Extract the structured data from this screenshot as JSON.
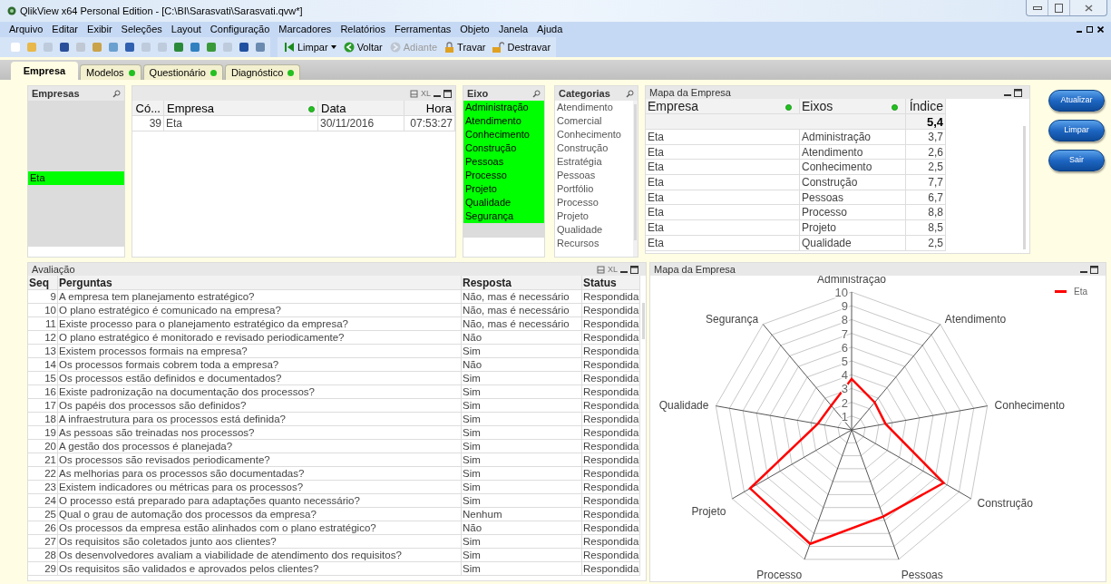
{
  "window": {
    "title": "QlikView x64 Personal Edition - [C:\\BI\\Sarasvati\\Sarasvati.qvw*]"
  },
  "menu": [
    "Arquivo",
    "Editar",
    "Exibir",
    "Seleções",
    "Layout",
    "Configuração",
    "Marcadores",
    "Relatórios",
    "Ferramentas",
    "Objeto",
    "Janela",
    "Ajuda"
  ],
  "toolbar": [
    {
      "kind": "clear",
      "label": "Limpar",
      "disabled": false
    },
    {
      "kind": "back",
      "label": "Voltar",
      "disabled": false
    },
    {
      "kind": "forward",
      "label": "Adiante",
      "disabled": true
    },
    {
      "kind": "lock",
      "label": "Travar",
      "disabled": false
    },
    {
      "kind": "unlock",
      "label": "Destravar",
      "disabled": false
    }
  ],
  "tabs": [
    {
      "label": "Empresa",
      "selected": true,
      "dot": false
    },
    {
      "label": "Modelos",
      "selected": false,
      "dot": true
    },
    {
      "label": "Questionário",
      "selected": false,
      "dot": true
    },
    {
      "label": "Diagnóstico",
      "selected": false,
      "dot": true
    }
  ],
  "empresas_list": {
    "title": "Empresas",
    "items": [
      {
        "label": "Eta",
        "selected": true
      }
    ]
  },
  "registro_table": {
    "export_label": "XL",
    "columns": [
      {
        "label": "Có...",
        "filtered": false
      },
      {
        "label": "Empresa",
        "filtered": true
      },
      {
        "label": "Data",
        "filtered": false
      },
      {
        "label": "Hora",
        "filtered": false
      }
    ],
    "rows": [
      [
        "39",
        "Eta",
        "30/11/2016",
        "07:53:27"
      ]
    ]
  },
  "eixo_list": {
    "title": "Eixo",
    "items": [
      {
        "label": "Administração",
        "selected": true
      },
      {
        "label": "Atendimento",
        "selected": true
      },
      {
        "label": "Conhecimento",
        "selected": true
      },
      {
        "label": "Construção",
        "selected": true
      },
      {
        "label": "Pessoas",
        "selected": true
      },
      {
        "label": "Processo",
        "selected": true
      },
      {
        "label": "Projeto",
        "selected": true
      },
      {
        "label": "Qualidade",
        "selected": true
      },
      {
        "label": "Segurança",
        "selected": true
      }
    ]
  },
  "categorias_list": {
    "title": "Categorias",
    "items": [
      {
        "label": "Atendimento",
        "selected": false
      },
      {
        "label": "Comercial",
        "selected": false
      },
      {
        "label": "Conhecimento",
        "selected": false
      },
      {
        "label": "Construção",
        "selected": false
      },
      {
        "label": "Estratégia",
        "selected": false
      },
      {
        "label": "Pessoas",
        "selected": false
      },
      {
        "label": "Portfólio",
        "selected": false
      },
      {
        "label": "Processo",
        "selected": false
      },
      {
        "label": "Projeto",
        "selected": false
      },
      {
        "label": "Qualidade",
        "selected": false
      },
      {
        "label": "Recursos",
        "selected": false
      }
    ]
  },
  "mapa_table": {
    "title": "Mapa da Empresa",
    "columns": [
      {
        "label": "Empresa",
        "filtered": true
      },
      {
        "label": "Eixos",
        "filtered": true
      },
      {
        "label": "Índice",
        "filtered": false
      }
    ],
    "total": "5,4",
    "rows": [
      [
        "Eta",
        "Administração",
        "3,7"
      ],
      [
        "Eta",
        "Atendimento",
        "2,6"
      ],
      [
        "Eta",
        "Conhecimento",
        "2,5"
      ],
      [
        "Eta",
        "Construção",
        "7,7"
      ],
      [
        "Eta",
        "Pessoas",
        "6,7"
      ],
      [
        "Eta",
        "Processo",
        "8,8"
      ],
      [
        "Eta",
        "Projeto",
        "8,5"
      ],
      [
        "Eta",
        "Qualidade",
        "2,5"
      ]
    ]
  },
  "buttons": [
    "Atualizar",
    "Limpar",
    "Sair"
  ],
  "avaliacao": {
    "title": "Avaliação",
    "export_label": "XL",
    "columns": [
      "Seq",
      "Perguntas",
      "Resposta",
      "Status"
    ],
    "rows": [
      [
        "9",
        "A empresa tem planejamento estratégico?",
        "Não, mas é necessário",
        "Respondida"
      ],
      [
        "10",
        "O plano estratégico é comunicado na empresa?",
        "Não, mas é necessário",
        "Respondida"
      ],
      [
        "11",
        "Existe processo para o planejamento estratégico da empresa?",
        "Não, mas é necessário",
        "Respondida"
      ],
      [
        "12",
        "O plano estratégico é monitorado e revisado periodicamente?",
        "Não",
        "Respondida"
      ],
      [
        "13",
        "Existem processos formais na empresa?",
        "Sim",
        "Respondida"
      ],
      [
        "14",
        "Os processos formais cobrem toda a empresa?",
        "Não",
        "Respondida"
      ],
      [
        "15",
        "Os processos estão definidos e documentados?",
        "Sim",
        "Respondida"
      ],
      [
        "16",
        "Existe padronização na documentação dos processos?",
        "Sim",
        "Respondida"
      ],
      [
        "17",
        "Os papéis dos processos são definidos?",
        "Sim",
        "Respondida"
      ],
      [
        "18",
        "A infraestrutura para os processos está definida?",
        "Sim",
        "Respondida"
      ],
      [
        "19",
        "As pessoas são treinadas nos processos?",
        "Sim",
        "Respondida"
      ],
      [
        "20",
        "A gestão dos processos é planejada?",
        "Sim",
        "Respondida"
      ],
      [
        "21",
        "Os processos são revisados periodicamente?",
        "Sim",
        "Respondida"
      ],
      [
        "22",
        "As melhorias para os processos são documentadas?",
        "Sim",
        "Respondida"
      ],
      [
        "23",
        "Existem indicadores ou métricas para os processos?",
        "Sim",
        "Respondida"
      ],
      [
        "24",
        "O processo está preparado para adaptações quanto necessário?",
        "Sim",
        "Respondida"
      ],
      [
        "25",
        "Qual o grau de automação dos processos da empresa?",
        "Nenhum",
        "Respondida"
      ],
      [
        "26",
        "Os processos da empresa estão alinhados com o plano estratégico?",
        "Não",
        "Respondida"
      ],
      [
        "27",
        "Os requisitos são coletados junto aos clientes?",
        "Sim",
        "Respondida"
      ],
      [
        "28",
        "Os desenvolvedores avaliam a viabilidade de atendimento dos requisitos?",
        "Sim",
        "Respondida"
      ],
      [
        "29",
        "Os requisitos são validados e aprovados pelos clientes?",
        "Sim",
        "Respondida"
      ]
    ]
  },
  "chart_panel": {
    "title": "Mapa da Empresa",
    "axis_labels": [
      "Administração",
      "Atendimento",
      "Conhecimento",
      "Construção",
      "Pessoas",
      "Processo",
      "Projeto",
      "Qualidade",
      "Segurança"
    ],
    "tick_labels": [
      "10",
      "9",
      "8",
      "7",
      "6",
      "5",
      "4",
      "3",
      "2",
      "1"
    ],
    "legend": [
      {
        "name": "Eta",
        "color": "#ff0000"
      }
    ]
  }
}
